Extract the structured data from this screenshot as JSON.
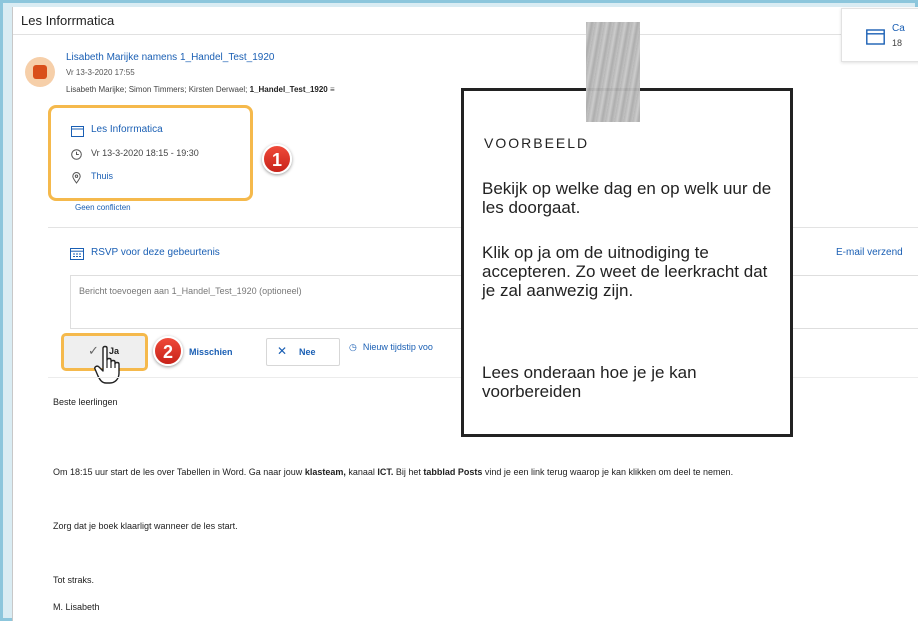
{
  "window": {
    "title": "Les Inforrmatica"
  },
  "calendar_card": {
    "label_partial": "Ca",
    "value_partial": "18"
  },
  "message": {
    "sender": "Lisabeth Marijke namens 1_Handel_Test_1920",
    "sent": "Vr 13-3-2020 17:55",
    "recipients_prefix": "Lisabeth Marijke; Simon Timmers; Kirsten Derwael; ",
    "recipients_group": "1_Handel_Test_1920",
    "recipients_suffix": " ≡"
  },
  "event": {
    "title": "Les Inforrmatica",
    "time": "Vr 13-3-2020 18:15 - 19:30",
    "location": "Thuis",
    "conflicts": "Geen conflicten"
  },
  "badges": {
    "one": "1",
    "two": "2"
  },
  "rsvp": {
    "title": "RSVP voor deze gebeurtenis",
    "email_send": "E-mail verzend",
    "message_placeholder": "Bericht toevoegen aan 1_Handel_Test_1920 (optioneel)",
    "yes": "Ja",
    "maybe": "Misschien",
    "no": "Nee",
    "new_time": "Nieuw tijdstip voo"
  },
  "body": {
    "greeting": "Beste leerlingen",
    "p2_a": "Om 18:15 uur start de les over Tabellen in Word. Ga naar jouw ",
    "p2_b": "klasteam,",
    "p2_c": " kanaal ",
    "p2_d": "ICT.",
    "p2_e": " Bij het ",
    "p2_f": "tabblad Posts",
    "p2_g": " vind je een link terug waarop je kan klikken om deel te nemen.",
    "p3": "Zorg dat je boek klaarligt wanneer de les start.",
    "closing": "Tot straks.",
    "signature": "M. Lisabeth"
  },
  "overlay": {
    "heading": "VOORBEELD",
    "p1": "Bekijk op welke dag en op welk uur de les doorgaat.",
    "p2": "Klik op ja om de uitnodiging te accepteren. Zo weet de leerkracht dat je zal aanwezig zijn.",
    "p3": "Lees onderaan hoe je je kan voorbereiden"
  },
  "colors": {
    "link": "#1a5fb4",
    "highlight": "#f5b94c",
    "badge": "#e0382b",
    "frame": "#d9ecf3"
  }
}
